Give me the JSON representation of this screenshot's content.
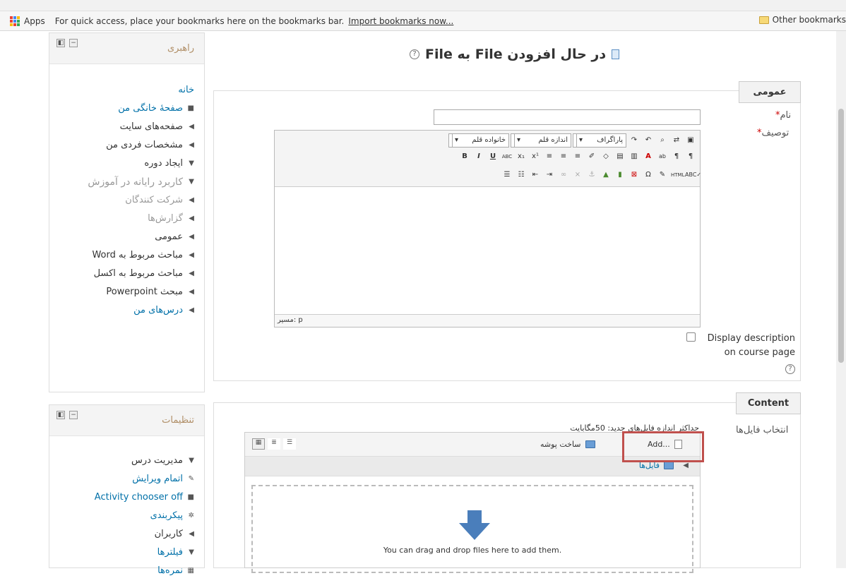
{
  "bookmarks_bar": {
    "apps_label": "Apps",
    "hint": "For quick access, place your bookmarks here on the bookmarks bar.",
    "import_link": "Import bookmarks now...",
    "other_bookmarks": "Other bookmarks"
  },
  "nav_block": {
    "title": "راهبری",
    "items": [
      {
        "label": "خانه",
        "kind": "link"
      },
      {
        "label": "صفحهٔ خانگی من",
        "kind": "link-bullet"
      },
      {
        "label": "صفحه‌های سایت",
        "kind": "collapsed"
      },
      {
        "label": "مشخصات فردی من",
        "kind": "collapsed"
      },
      {
        "label": "ایجاد دوره",
        "kind": "expanded"
      },
      {
        "label": "کاربرد رایانه در آموزش",
        "kind": "expanded-big"
      },
      {
        "label": "شرکت کنندگان",
        "kind": "collapsed-dim"
      },
      {
        "label": "گزارش‌ها",
        "kind": "collapsed-dim"
      },
      {
        "label": "عمومی",
        "kind": "collapsed"
      },
      {
        "label": "مباحث مربوط به Word",
        "kind": "collapsed"
      },
      {
        "label": "مباحث مربوط به اکسل",
        "kind": "collapsed"
      },
      {
        "label": "مبحث Powerpoint",
        "kind": "collapsed"
      },
      {
        "label": "درس‌های من",
        "kind": "collapsed-link"
      }
    ]
  },
  "settings_block": {
    "title": "تنظیمات",
    "items": [
      {
        "label": "مدیریت درس",
        "kind": "expanded"
      },
      {
        "label": "اتمام ویرایش",
        "kind": "link-pencil"
      },
      {
        "label": "Activity chooser off",
        "kind": "link-bullet"
      },
      {
        "label": "پیکربندی",
        "kind": "link-gear"
      },
      {
        "label": "کاربران",
        "kind": "collapsed"
      },
      {
        "label": "فیلترها",
        "kind": "link-filter"
      },
      {
        "label": "نمره‌ها",
        "kind": "link-grid"
      }
    ]
  },
  "page": {
    "title": "در حال افزودن File به"
  },
  "general_section": {
    "legend": "عمومی",
    "name_label": "نام",
    "name_value": "",
    "description_label": "توصیف",
    "editor": {
      "font_family": "خانواده قلم",
      "font_size": "اندازه قلم",
      "paragraph": "پاراگراف",
      "path": "مسیر: p"
    },
    "display_description": "Display description on course page"
  },
  "content_section": {
    "legend": "Content",
    "files_label": "انتخاب فایل‌ها",
    "max_size": "حداکثر اندازه فایل‌های جدید: 50مگابایت",
    "add_button": "Add...",
    "create_folder": "ساخت پوشه",
    "path_folder": "فایل‌ها",
    "drop_hint": "You can drag and drop files here to add them."
  },
  "colors": {
    "link": "#0070a8",
    "block_title": "#b08e66",
    "highlight": "#c0504d",
    "drop_arrow": "#4a7ebb"
  }
}
